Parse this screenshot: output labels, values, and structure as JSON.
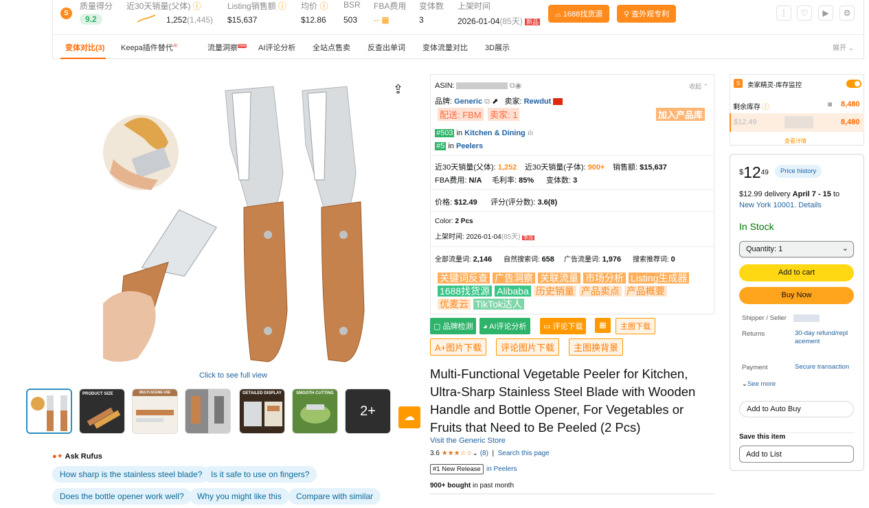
{
  "metrics": {
    "quality_label": "质量得分",
    "quality_value": "9.2",
    "sales30_label": "近30天销量(父体)",
    "sales30_value": "1,252",
    "sales30_sub": "(1,445)",
    "listing_label": "Listing销售额",
    "listing_value": "$15,637",
    "avg_label": "均价",
    "avg_value": "$12.86",
    "bsr_label": "BSR",
    "bsr_value": "503",
    "fba_label": "FBA费用",
    "fba_value": "--",
    "variants_label": "变体数",
    "variants_value": "3",
    "launch_label": "上架时间",
    "launch_value": "2026-01-04",
    "launch_days": "(85天)",
    "new_badge": "新品",
    "btn_source": "1688找货源",
    "btn_patent": "查外观专利"
  },
  "tabs": [
    {
      "label": "变体对比(3)"
    },
    {
      "label": "Keepa插件替代",
      "badge": "AI"
    },
    {
      "label": "流量洞察",
      "badge": "new"
    },
    {
      "label": "AI评论分析"
    },
    {
      "label": "全站点售卖"
    },
    {
      "label": "反查出单词"
    },
    {
      "label": "变体流量对比"
    },
    {
      "label": "3D展示"
    }
  ],
  "expand_label": "展开",
  "gallery": {
    "click_full": "Click to see full view",
    "thumb_labels": [
      "",
      "PRODUCT SIZE",
      "MULTI-SCENE USE",
      "",
      "DETAILED DISPLAY",
      "SMOOTH CUTTING",
      "2+"
    ]
  },
  "rufus": {
    "title": "Ask Rufus",
    "questions": [
      "How sharp is the stainless steel blade?",
      "Is it safe to use on fingers?",
      "Does the bottle opener work well?",
      "Why you might like this",
      "Compare with similar"
    ]
  },
  "plugin": {
    "asin_label": "ASIN:",
    "collapse": "收起",
    "brand_label": "品牌:",
    "brand_value": "Generic",
    "seller_label": "卖家:",
    "seller_value": "Rewdut",
    "ship": "配送: FBM",
    "sellers": "卖家: 1",
    "add_lib": "加入产品库",
    "rank1_badge": "#503",
    "rank1_text": "in",
    "rank1_cat": "Kitchen & Dining",
    "rank2_badge": "#5",
    "rank2_text": "in",
    "rank2_cat": "Peelers",
    "row1": [
      {
        "k": "近30天销量(父体):",
        "v": "1,252"
      },
      {
        "k": "近30天销量(子体):",
        "v": "900+"
      },
      {
        "k": "销售额:",
        "v": "$15,637"
      }
    ],
    "row2": [
      {
        "k": "FBA费用:",
        "v": "N/A"
      },
      {
        "k": "毛利率:",
        "v": "85%"
      },
      {
        "k": "变体数:",
        "v": "3"
      }
    ],
    "price_label": "价格:",
    "price_value": "$12.49",
    "rating_label": "评分(评分数):",
    "rating_value": "3.6(8)",
    "color_label": "Color:",
    "color_value": "2 Pcs",
    "launch_label": "上架时间:",
    "launch_value": "2026-01-04",
    "launch_days": "(85天)",
    "new_badge": "新品",
    "traffic": [
      {
        "k": "全部流量词:",
        "v": "2,146"
      },
      {
        "k": "自然搜索词:",
        "v": "658"
      },
      {
        "k": "广告流量词:",
        "v": "1,976"
      },
      {
        "k": "搜索推荐词:",
        "v": "0"
      }
    ],
    "tags_row1": [
      "关键词反查",
      "广告洞察",
      "关联流量",
      "市场分析",
      "Listing生成器"
    ],
    "tags_row2": [
      "1688找货源",
      "Alibaba",
      "历史销量",
      "产品卖点",
      "产品概要"
    ],
    "tags_row3": [
      "优麦云",
      "TikTok达人"
    ],
    "actions1": [
      "品牌检测",
      "AI评论分析",
      "评论下载",
      "主图下载"
    ],
    "actions2": [
      "A+图片下载",
      "评论图片下载",
      "主图换背景"
    ]
  },
  "product": {
    "title": "Multi-Functional Vegetable Peeler for Kitchen, Ultra-Sharp Stainless Steel Blade with Wooden Handle and Bottle Opener, For Vegetables or Fruits that Need to Be Peeled (2 Pcs)",
    "store": "Visit the Generic Store",
    "rating": "3.6",
    "stars": "★★★☆☆",
    "reviews": "(8)",
    "search_page": "Search this page",
    "badge": "#1 New Release",
    "badge_cat": "in Peelers",
    "bought": "900+ bought",
    "bought_suffix": "in past month"
  },
  "inventory": {
    "title": "卖家精灵-库存监控",
    "stock_label": "剩余库存",
    "stock_value": "8,480",
    "row_price": "$12.49",
    "row_value": "8,480",
    "details": "查看详情"
  },
  "buybox": {
    "currency": "$",
    "price_whole": "12",
    "price_frac": "49",
    "price_history": "Price history",
    "delivery_prefix": "$12.99 delivery",
    "delivery_date": "April 7 - 15",
    "delivery_to": "to",
    "location": "New York 10001.",
    "details": "Details",
    "in_stock": "In Stock",
    "quantity": "Quantity: 1",
    "add_cart": "Add to cart",
    "buy_now": "Buy Now",
    "shipper_label": "Shipper / Seller",
    "returns_label": "Returns",
    "returns_value": "30-day refund/replacement",
    "payment_label": "Payment",
    "payment_value": "Secure transaction",
    "see_more": "See more",
    "auto_buy": "Add to Auto Buy",
    "save_item": "Save this item",
    "add_list": "Add to List"
  },
  "colors": {
    "orange": "#ff8a1c",
    "green": "#2db36a",
    "amazon_yellow": "#ffd814",
    "amazon_orange": "#ffa41c",
    "link": "#2162a1"
  }
}
